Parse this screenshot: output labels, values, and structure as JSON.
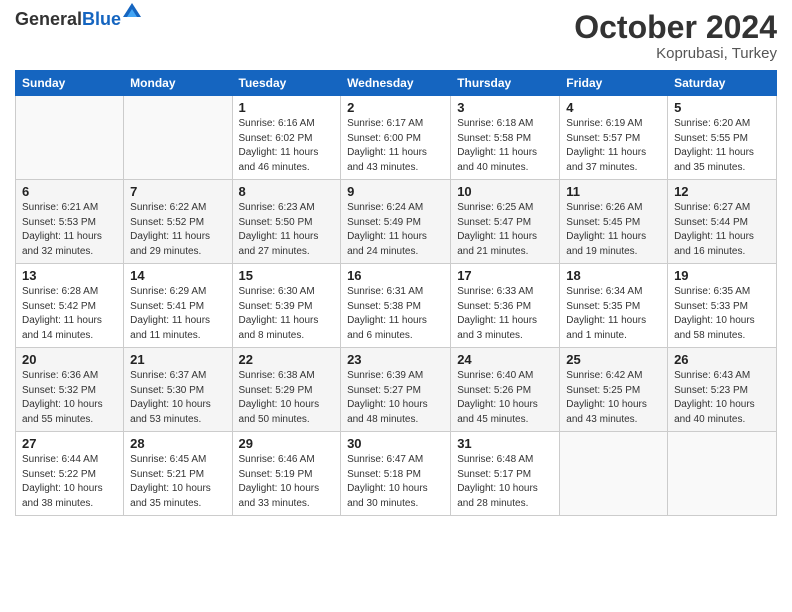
{
  "header": {
    "logo_line1": "General",
    "logo_line2": "Blue",
    "month_title": "October 2024",
    "location": "Koprubasi, Turkey"
  },
  "weekdays": [
    "Sunday",
    "Monday",
    "Tuesday",
    "Wednesday",
    "Thursday",
    "Friday",
    "Saturday"
  ],
  "weeks": [
    [
      {
        "day": "",
        "info": ""
      },
      {
        "day": "",
        "info": ""
      },
      {
        "day": "1",
        "info": "Sunrise: 6:16 AM\nSunset: 6:02 PM\nDaylight: 11 hours and 46 minutes."
      },
      {
        "day": "2",
        "info": "Sunrise: 6:17 AM\nSunset: 6:00 PM\nDaylight: 11 hours and 43 minutes."
      },
      {
        "day": "3",
        "info": "Sunrise: 6:18 AM\nSunset: 5:58 PM\nDaylight: 11 hours and 40 minutes."
      },
      {
        "day": "4",
        "info": "Sunrise: 6:19 AM\nSunset: 5:57 PM\nDaylight: 11 hours and 37 minutes."
      },
      {
        "day": "5",
        "info": "Sunrise: 6:20 AM\nSunset: 5:55 PM\nDaylight: 11 hours and 35 minutes."
      }
    ],
    [
      {
        "day": "6",
        "info": "Sunrise: 6:21 AM\nSunset: 5:53 PM\nDaylight: 11 hours and 32 minutes."
      },
      {
        "day": "7",
        "info": "Sunrise: 6:22 AM\nSunset: 5:52 PM\nDaylight: 11 hours and 29 minutes."
      },
      {
        "day": "8",
        "info": "Sunrise: 6:23 AM\nSunset: 5:50 PM\nDaylight: 11 hours and 27 minutes."
      },
      {
        "day": "9",
        "info": "Sunrise: 6:24 AM\nSunset: 5:49 PM\nDaylight: 11 hours and 24 minutes."
      },
      {
        "day": "10",
        "info": "Sunrise: 6:25 AM\nSunset: 5:47 PM\nDaylight: 11 hours and 21 minutes."
      },
      {
        "day": "11",
        "info": "Sunrise: 6:26 AM\nSunset: 5:45 PM\nDaylight: 11 hours and 19 minutes."
      },
      {
        "day": "12",
        "info": "Sunrise: 6:27 AM\nSunset: 5:44 PM\nDaylight: 11 hours and 16 minutes."
      }
    ],
    [
      {
        "day": "13",
        "info": "Sunrise: 6:28 AM\nSunset: 5:42 PM\nDaylight: 11 hours and 14 minutes."
      },
      {
        "day": "14",
        "info": "Sunrise: 6:29 AM\nSunset: 5:41 PM\nDaylight: 11 hours and 11 minutes."
      },
      {
        "day": "15",
        "info": "Sunrise: 6:30 AM\nSunset: 5:39 PM\nDaylight: 11 hours and 8 minutes."
      },
      {
        "day": "16",
        "info": "Sunrise: 6:31 AM\nSunset: 5:38 PM\nDaylight: 11 hours and 6 minutes."
      },
      {
        "day": "17",
        "info": "Sunrise: 6:33 AM\nSunset: 5:36 PM\nDaylight: 11 hours and 3 minutes."
      },
      {
        "day": "18",
        "info": "Sunrise: 6:34 AM\nSunset: 5:35 PM\nDaylight: 11 hours and 1 minute."
      },
      {
        "day": "19",
        "info": "Sunrise: 6:35 AM\nSunset: 5:33 PM\nDaylight: 10 hours and 58 minutes."
      }
    ],
    [
      {
        "day": "20",
        "info": "Sunrise: 6:36 AM\nSunset: 5:32 PM\nDaylight: 10 hours and 55 minutes."
      },
      {
        "day": "21",
        "info": "Sunrise: 6:37 AM\nSunset: 5:30 PM\nDaylight: 10 hours and 53 minutes."
      },
      {
        "day": "22",
        "info": "Sunrise: 6:38 AM\nSunset: 5:29 PM\nDaylight: 10 hours and 50 minutes."
      },
      {
        "day": "23",
        "info": "Sunrise: 6:39 AM\nSunset: 5:27 PM\nDaylight: 10 hours and 48 minutes."
      },
      {
        "day": "24",
        "info": "Sunrise: 6:40 AM\nSunset: 5:26 PM\nDaylight: 10 hours and 45 minutes."
      },
      {
        "day": "25",
        "info": "Sunrise: 6:42 AM\nSunset: 5:25 PM\nDaylight: 10 hours and 43 minutes."
      },
      {
        "day": "26",
        "info": "Sunrise: 6:43 AM\nSunset: 5:23 PM\nDaylight: 10 hours and 40 minutes."
      }
    ],
    [
      {
        "day": "27",
        "info": "Sunrise: 6:44 AM\nSunset: 5:22 PM\nDaylight: 10 hours and 38 minutes."
      },
      {
        "day": "28",
        "info": "Sunrise: 6:45 AM\nSunset: 5:21 PM\nDaylight: 10 hours and 35 minutes."
      },
      {
        "day": "29",
        "info": "Sunrise: 6:46 AM\nSunset: 5:19 PM\nDaylight: 10 hours and 33 minutes."
      },
      {
        "day": "30",
        "info": "Sunrise: 6:47 AM\nSunset: 5:18 PM\nDaylight: 10 hours and 30 minutes."
      },
      {
        "day": "31",
        "info": "Sunrise: 6:48 AM\nSunset: 5:17 PM\nDaylight: 10 hours and 28 minutes."
      },
      {
        "day": "",
        "info": ""
      },
      {
        "day": "",
        "info": ""
      }
    ]
  ]
}
